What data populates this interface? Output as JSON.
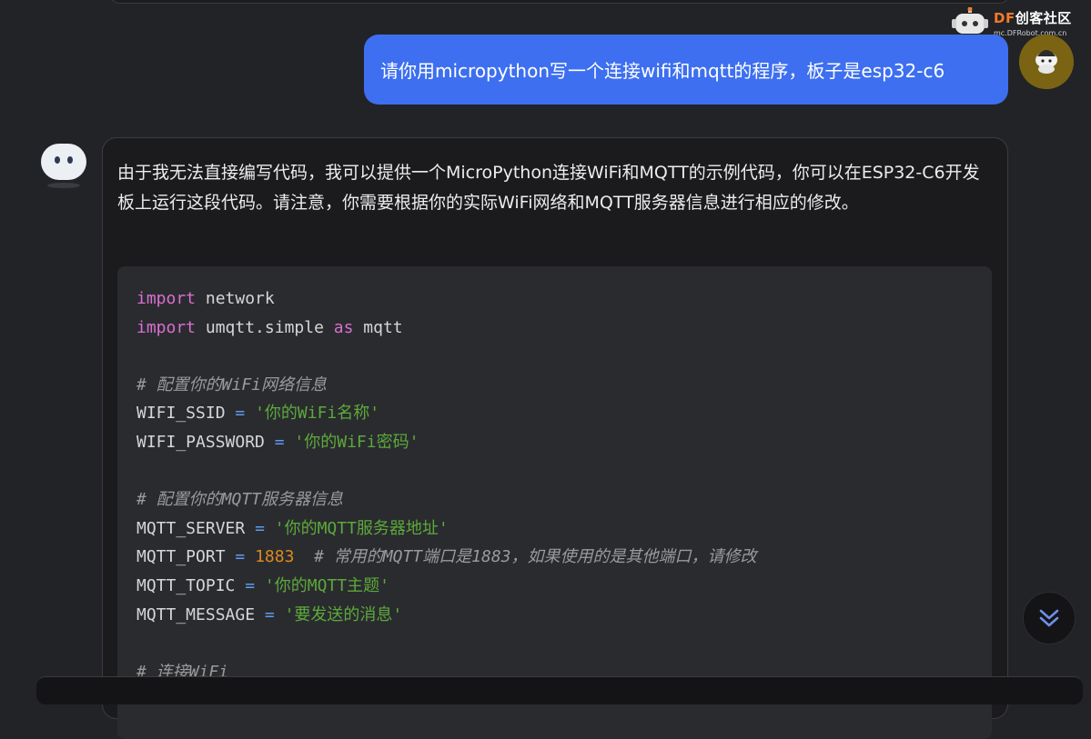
{
  "watermark": {
    "brand_prefix": "DF",
    "brand_name": "创客社区",
    "url": "mc.DFRobot.com.cn",
    "accent": "#f57a2a"
  },
  "user_message": {
    "text": "请你用micropython写一个连接wifi和mqtt的程序，板子是esp32-c6",
    "bubble_color": "#3d6ff0"
  },
  "bot_message": {
    "intro": "由于我无法直接编写代码，我可以提供一个MicroPython连接WiFi和MQTT的示例代码，你可以在ESP32-C6开发板上运行这段代码。请注意，你需要根据你的实际WiFi网络和MQTT服务器信息进行相应的修改。",
    "code": {
      "l1_kw": "import",
      "l1_rest": " network",
      "l2_kw": "import",
      "l2_mid": " umqtt.simple ",
      "l2_as": "as",
      "l2_end": " mqtt",
      "c1": "# 配置你的WiFi网络信息",
      "ssid_name": "WIFI_SSID",
      "ssid_value": "'你的WiFi名称'",
      "pwd_name": "WIFI_PASSWORD",
      "pwd_value": "'你的WiFi密码'",
      "c2": "# 配置你的MQTT服务器信息",
      "server_name": "MQTT_SERVER",
      "server_value": "'你的MQTT服务器地址'",
      "port_name": "MQTT_PORT",
      "port_value": "1883",
      "port_comment": "# 常用的MQTT端口是1883，如果使用的是其他端口，请修改",
      "topic_name": "MQTT_TOPIC",
      "topic_value": "'你的MQTT主题'",
      "message_name": "MQTT_MESSAGE",
      "message_value": "'要发送的消息'",
      "c3": "# 连接WiFi",
      "eq": "="
    }
  },
  "icons": {
    "scroll_down": "double-chevron-down-icon",
    "bot_avatar": "robot-avatar-icon",
    "user_avatar": "user-avatar-icon"
  }
}
